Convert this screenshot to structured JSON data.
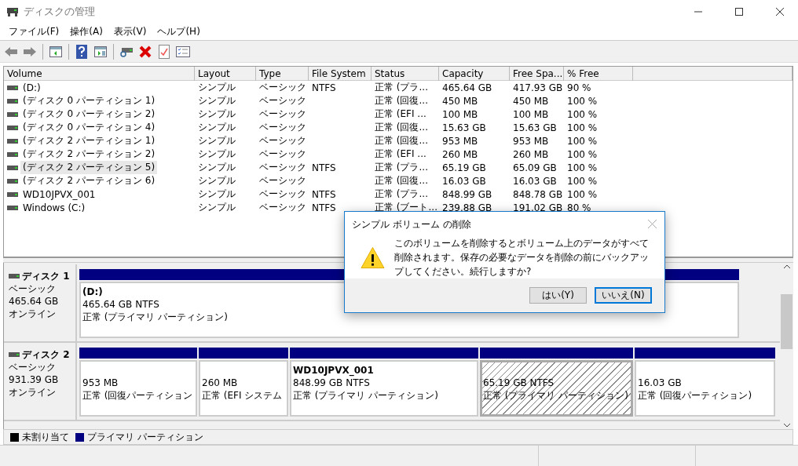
{
  "window": {
    "title": "ディスクの管理"
  },
  "menu": [
    "ファイル(F)",
    "操作(A)",
    "表示(V)",
    "ヘルプ(H)"
  ],
  "table": {
    "columns": [
      "Volume",
      "Layout",
      "Type",
      "File System",
      "Status",
      "Capacity",
      "Free Spa...",
      "% Free"
    ],
    "rows": [
      {
        "cells": [
          " (D:)",
          "シンプル",
          "ベーシック",
          "NTFS",
          "正常 (プラ...",
          "465.64 GB",
          "417.93 GB",
          "90 %"
        ],
        "selected": false
      },
      {
        "cells": [
          "(ディスク 0 パーティション 1)",
          "シンプル",
          "ベーシック",
          "",
          "正常 (回復...",
          "450 MB",
          "450 MB",
          "100 %"
        ],
        "selected": false
      },
      {
        "cells": [
          "(ディスク 0 パーティション 2)",
          "シンプル",
          "ベーシック",
          "",
          "正常 (EFI ...",
          "100 MB",
          "100 MB",
          "100 %"
        ],
        "selected": false
      },
      {
        "cells": [
          "(ディスク 0 パーティション 4)",
          "シンプル",
          "ベーシック",
          "",
          "正常 (回復...",
          "15.63 GB",
          "15.63 GB",
          "100 %"
        ],
        "selected": false
      },
      {
        "cells": [
          "(ディスク 2 パーティション 1)",
          "シンプル",
          "ベーシック",
          "",
          "正常 (回復...",
          "953 MB",
          "953 MB",
          "100 %"
        ],
        "selected": false
      },
      {
        "cells": [
          "(ディスク 2 パーティション 2)",
          "シンプル",
          "ベーシック",
          "",
          "正常 (EFI ...",
          "260 MB",
          "260 MB",
          "100 %"
        ],
        "selected": false
      },
      {
        "cells": [
          "(ディスク 2 パーティション 5)",
          "シンプル",
          "ベーシック",
          "NTFS",
          "正常 (プラ...",
          "65.19 GB",
          "65.09 GB",
          "100 %"
        ],
        "selected": true
      },
      {
        "cells": [
          "(ディスク 2 パーティション 6)",
          "シンプル",
          "ベーシック",
          "",
          "正常 (回復...",
          "16.03 GB",
          "16.03 GB",
          "100 %"
        ],
        "selected": false
      },
      {
        "cells": [
          "WD10JPVX_001",
          "シンプル",
          "ベーシック",
          "NTFS",
          "正常 (プラ...",
          "848.99 GB",
          "848.78 GB",
          "100 %"
        ],
        "selected": false
      },
      {
        "cells": [
          "Windows (C:)",
          "シンプル",
          "ベーシック",
          "NTFS",
          "正常 (ブート...",
          "239.88 GB",
          "191.02 GB",
          "80 %"
        ],
        "selected": false
      }
    ]
  },
  "disks": [
    {
      "name": "ディスク 1",
      "type": "ベーシック",
      "size": "465.64 GB",
      "state": "オンライン",
      "partitions": [
        {
          "name": "(D:)",
          "size": "465.64 GB NTFS",
          "status": "正常 (プライマリ パーティション)",
          "selected": false
        }
      ]
    },
    {
      "name": "ディスク 2",
      "type": "ベーシック",
      "size": "931.39 GB",
      "state": "オンライン",
      "partitions": [
        {
          "size": "953 MB",
          "status": "正常 (回復パーティション",
          "selected": false
        },
        {
          "size": "260 MB",
          "status": "正常 (EFI システム",
          "selected": false
        },
        {
          "name": "WD10JPVX_001",
          "size": "848.99 GB NTFS",
          "status": "正常 (プライマリ パーティション)",
          "selected": false
        },
        {
          "size": "65.19 GB NTFS",
          "status": "正常 (プライマリ パーティション)",
          "selected": true
        },
        {
          "size": "16.03 GB",
          "status": "正常 (回復パーティション)",
          "selected": false
        }
      ]
    }
  ],
  "legend": [
    {
      "label": "未割り当て",
      "color": "#000000"
    },
    {
      "label": "プライマリ パーティション",
      "color": "#000080"
    }
  ],
  "dialog": {
    "title": "シンプル ボリューム の削除",
    "message": "このボリュームを削除するとボリューム上のデータがすべて削除されます。保存の必要なデータを削除の前にバックアップしてください。続行しますか?",
    "buttons": [
      {
        "label": "はい(Y)",
        "selected": false
      },
      {
        "label": "いいえ(N)",
        "selected": true
      }
    ]
  }
}
